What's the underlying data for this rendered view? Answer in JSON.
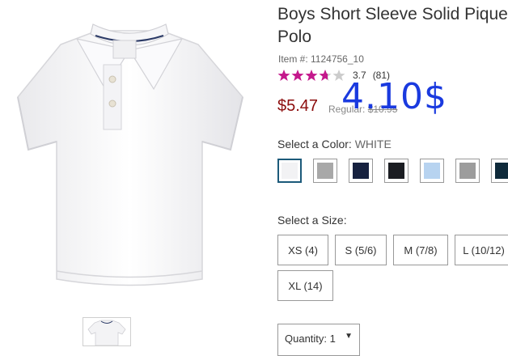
{
  "product": {
    "title_line1": "Boys Short Sleeve Solid Pique",
    "title_line2": "Polo",
    "item_number": "Item #: 1124756_10",
    "rating": {
      "stars": 3.7,
      "value": "3.7",
      "count": "(81)",
      "star_color": "#c4188c",
      "empty_color": "#cccccc"
    },
    "price_sale": "$5.47",
    "price_regular_label": "Regular:",
    "price_regular_value": "$10.95",
    "overlay_price": "4.10$"
  },
  "color": {
    "label": "Select a Color:",
    "value": "WHITE",
    "swatches": [
      {
        "name": "white",
        "hex": "#f2f2f4",
        "selected": true
      },
      {
        "name": "heather gray",
        "hex": "#a8a8a8"
      },
      {
        "name": "navy",
        "hex": "#16213f"
      },
      {
        "name": "black",
        "hex": "#1b1d22"
      },
      {
        "name": "light blue",
        "hex": "#b7d3f0"
      },
      {
        "name": "gray",
        "hex": "#9c9c9c"
      },
      {
        "name": "dark navy",
        "hex": "#0f2a3a"
      }
    ]
  },
  "size": {
    "label": "Select a Size:",
    "options": [
      "XS (4)",
      "S (5/6)",
      "M (7/8)",
      "L (10/12)",
      "XL (14)"
    ]
  },
  "quantity": {
    "label": "Quantity:",
    "value": "1"
  }
}
